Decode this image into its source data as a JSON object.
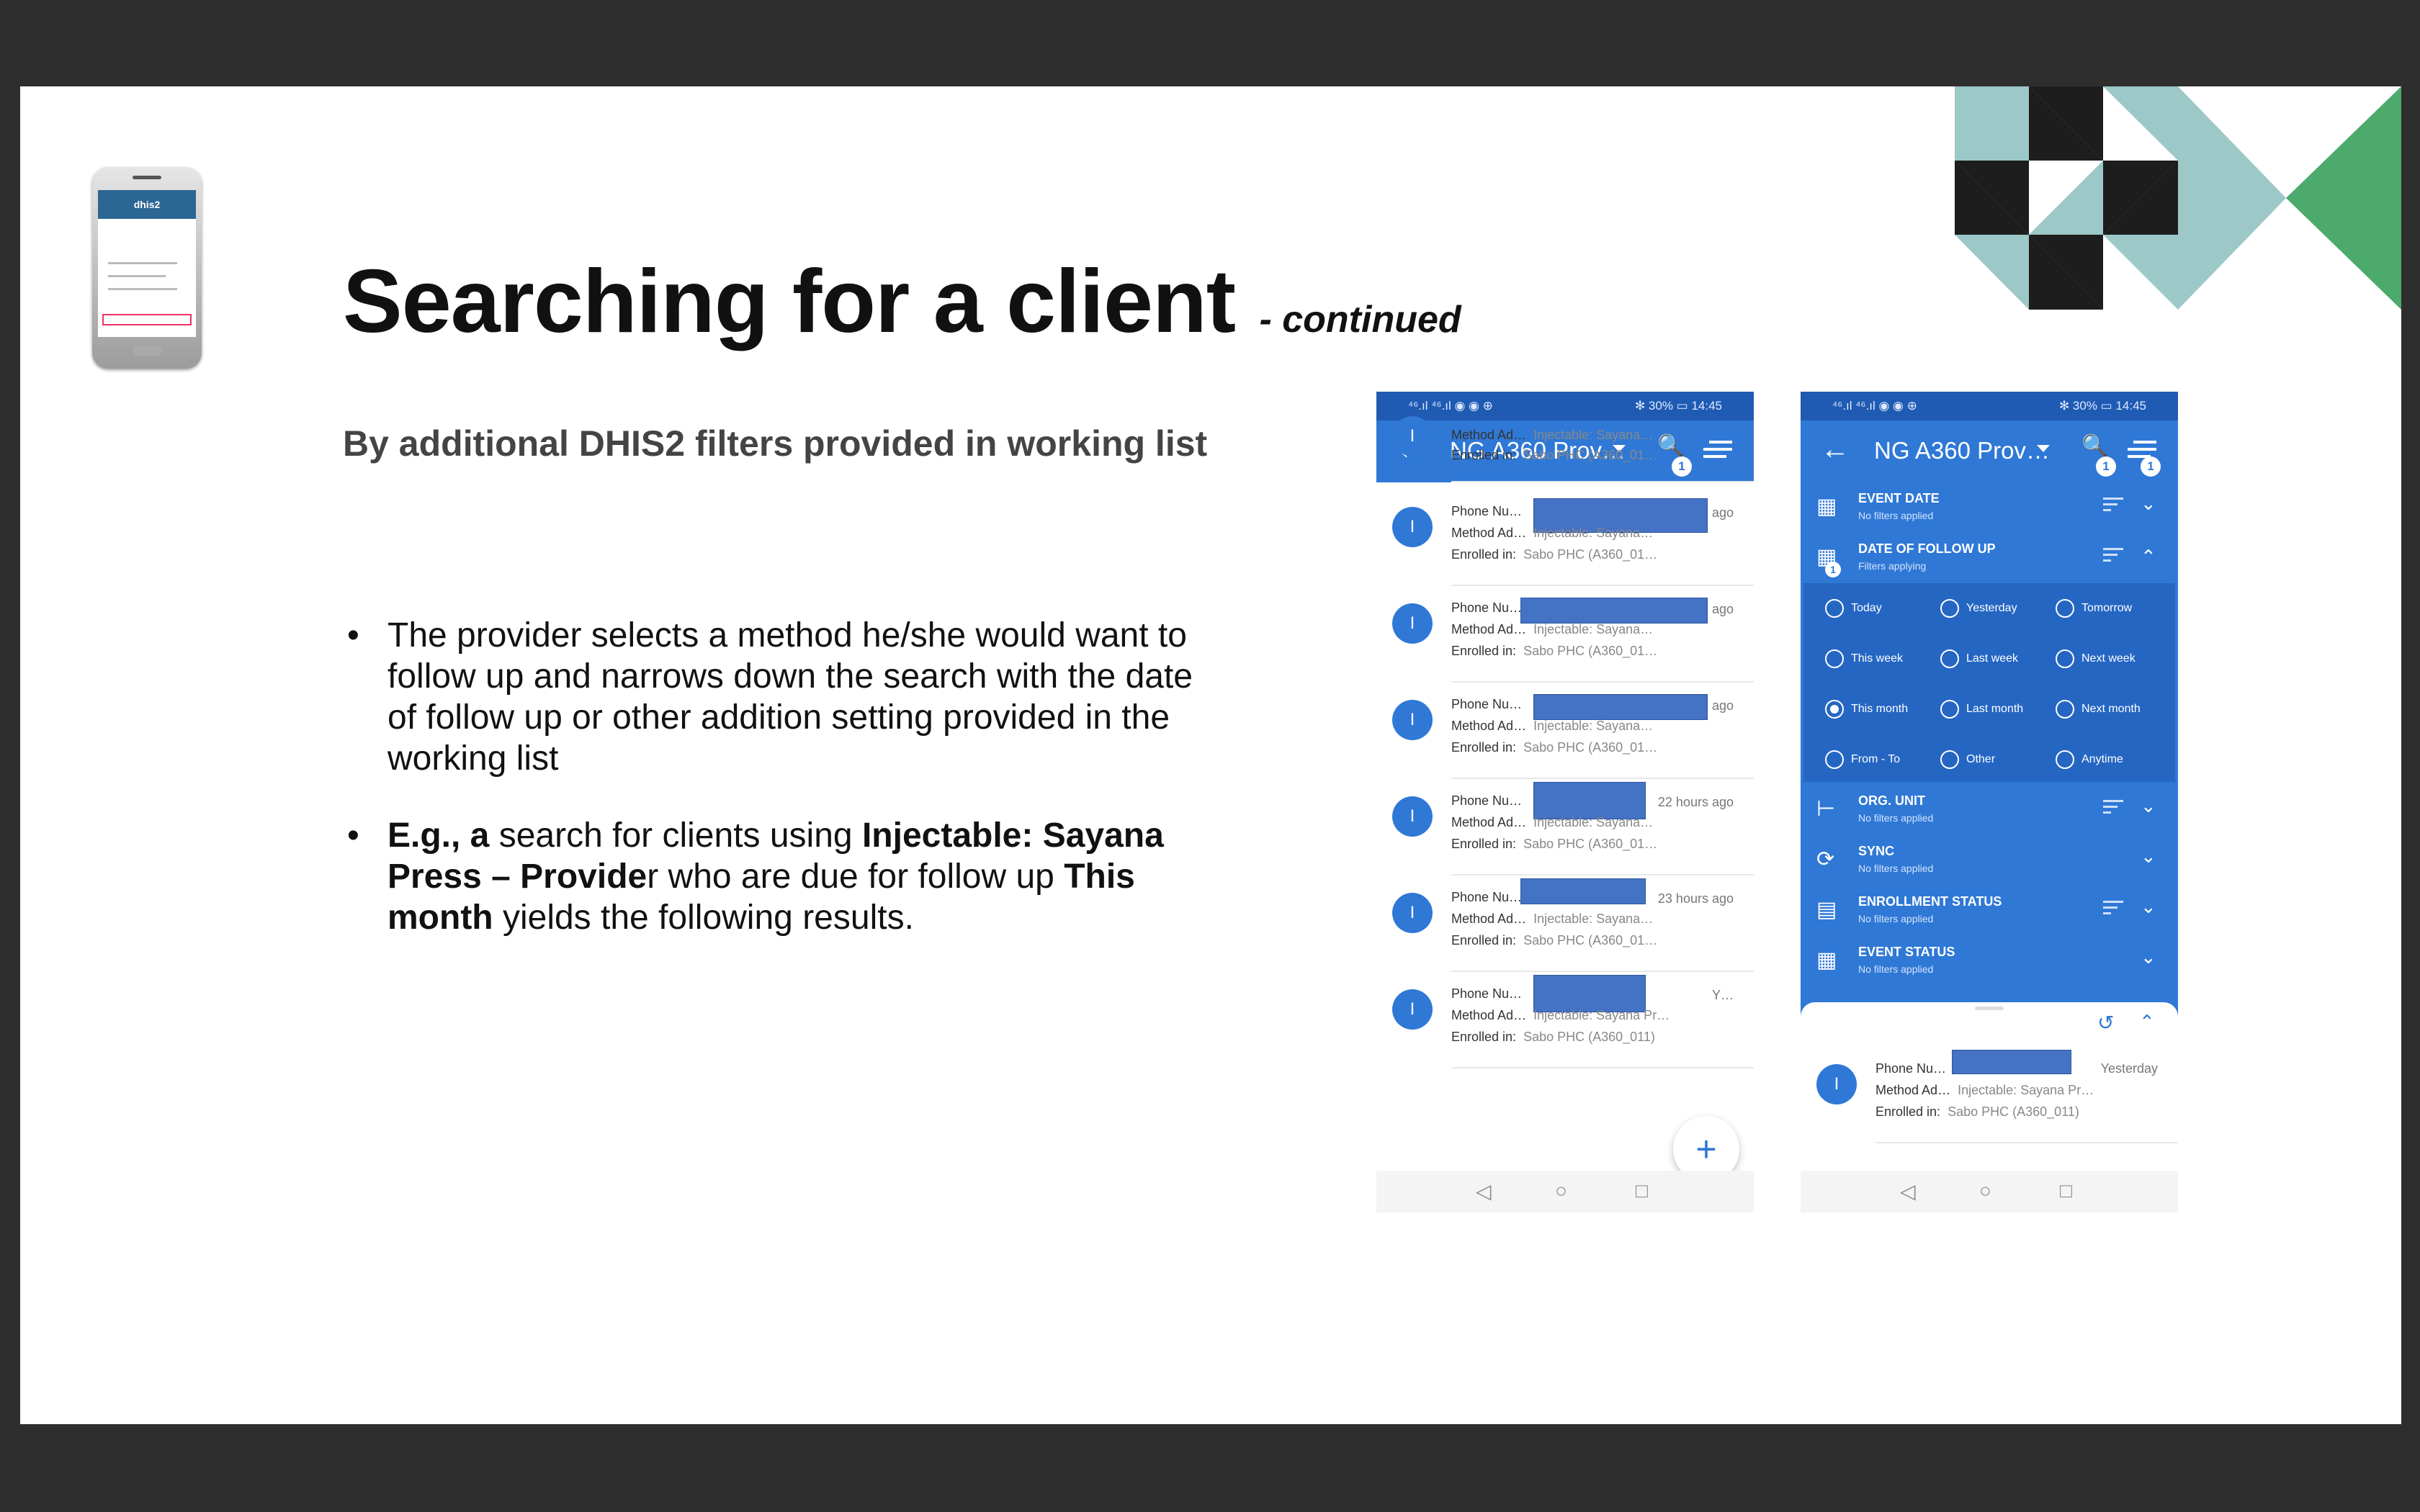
{
  "slide": {
    "title": "Searching for a client",
    "title_suffix": "- continued",
    "subtitle": "By additional DHIS2 filters provided in working list",
    "bullet1": "The provider selects a method he/she would want to follow up and narrows down the search with the date of follow up or other addition setting provided in the working list",
    "bullet2": {
      "b1": "E.g., a",
      "t1": " search for clients using ",
      "b2": "Injectable: Sayana Press – Provide",
      "t2": "r who are due for follow up ",
      "b3": "This month",
      "t3": " yields the following results."
    },
    "bullet_char": "•",
    "thumb_logo": "dhis2"
  },
  "phone_common": {
    "status_left": "⁴⁶.ıl ⁴⁶.ıl ◉ ◉ ⊕",
    "status_right": "✻ 30% ▭ 14:45",
    "app_title": "NG A360 Prov…",
    "back_icon": "←",
    "search_icon": "🔍",
    "badge_count": "1",
    "nav_back": "◁",
    "nav_home": "○",
    "nav_recent": "□",
    "avatar_letter": "I",
    "fab_label": "+"
  },
  "list_rows": [
    {
      "l1": "",
      "l2_label": "Method Ad…",
      "l2_value": "Injectable: Sayana…",
      "l3_label": "Enrolled in:",
      "l3_value": "Sabo PHC (A360_01…",
      "time": ""
    },
    {
      "l1": "Phone Nu…",
      "l2_label": "Method Ad…",
      "l2_value": "Injectable: Sayana…",
      "l3_label": "Enrolled in:",
      "l3_value": "Sabo PHC (A360_01…",
      "time": "ago"
    },
    {
      "l1": "Phone Nu…",
      "l2_label": "Method Ad…",
      "l2_value": "Injectable: Sayana…",
      "l3_label": "Enrolled in:",
      "l3_value": "Sabo PHC (A360_01…",
      "time": "ago"
    },
    {
      "l1": "Phone Nu…",
      "l2_label": "Method Ad…",
      "l2_value": "Injectable: Sayana…",
      "l3_label": "Enrolled in:",
      "l3_value": "Sabo PHC (A360_01…",
      "time": "ago"
    },
    {
      "l1": "Phone Nu…",
      "l2_label": "Method Ad…",
      "l2_value": "Injectable: Sayana…",
      "l3_label": "Enrolled in:",
      "l3_value": "Sabo PHC (A360_01…",
      "time": "22 hours ago"
    },
    {
      "l1": "Phone Nu…",
      "l2_label": "Method Ad…",
      "l2_value": "Injectable: Sayana…",
      "l3_label": "Enrolled in:",
      "l3_value": "Sabo PHC (A360_01…",
      "time": "23 hours ago"
    },
    {
      "l1": "Phone Nu…",
      "l2_label": "Method Ad…",
      "l2_value": "Injectable: Sayana Pr…",
      "l3_label": "Enrolled in:",
      "l3_value": "Sabo PHC (A360_011)",
      "time": "Y…"
    }
  ],
  "filters": {
    "sections": [
      {
        "title": "EVENT DATE",
        "sub": "No filters applied"
      },
      {
        "title": "DATE OF FOLLOW UP",
        "sub": "Filters applying"
      },
      {
        "title": "ORG. UNIT",
        "sub": "No filters applied"
      },
      {
        "title": "SYNC",
        "sub": "No filters applied"
      },
      {
        "title": "ENROLLMENT STATUS",
        "sub": "No filters applied"
      },
      {
        "title": "EVENT STATUS",
        "sub": "No filters applied"
      }
    ],
    "options": [
      "Today",
      "Yesterday",
      "Tomorrow",
      "This week",
      "Last week",
      "Next week",
      "This month",
      "Last month",
      "Next month",
      "From - To",
      "Other",
      "Anytime"
    ],
    "selected": "This month",
    "chev_down": "⌄",
    "chev_up": "⌃",
    "reset_icon": "↺"
  },
  "result_row": {
    "l1": "Phone Nu…",
    "l2_label": "Method Ad…",
    "l2_value": "Injectable: Sayana Pr…",
    "l3_label": "Enrolled in:",
    "l3_value": "Sabo PHC (A360_011)",
    "time": "Yesterday"
  },
  "colors": {
    "status_bar": "#1f5bb3",
    "primary": "#2f78d6",
    "redaction": "#4472c4",
    "teal": "#9cc8c8",
    "green": "#4caa6c"
  }
}
